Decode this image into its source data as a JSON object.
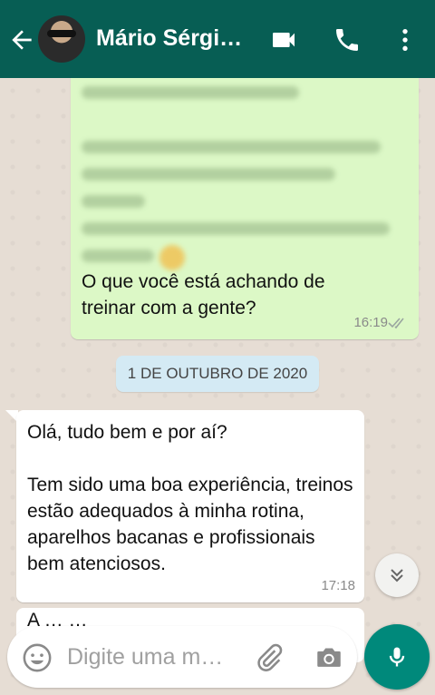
{
  "header": {
    "contact_name": "Mário Sérgi…"
  },
  "messages": {
    "outgoing_text": "O que você está achando de treinar com a gente?",
    "outgoing_time": "16:19",
    "date_separator": "1 DE OUTUBRO DE 2020",
    "incoming_line1": "Olá, tudo bem e por aí?",
    "incoming_body": "Tem sido uma boa experiência, treinos estão adequados à minha rotina, aparelhos bacanas e profissionais bem atenciosos.",
    "incoming_time": "17:18",
    "partial_next": "A … …"
  },
  "composer": {
    "placeholder": "Digite uma m…"
  },
  "colors": {
    "header": "#075e54",
    "outgoing_bubble": "#dcf8c6",
    "mic_button": "#00897b"
  },
  "icons": [
    "back-arrow-icon",
    "video-call-icon",
    "phone-icon",
    "more-vert-icon",
    "emoji-icon",
    "attach-icon",
    "camera-icon",
    "mic-icon",
    "scroll-down-icon",
    "read-ticks-icon"
  ]
}
